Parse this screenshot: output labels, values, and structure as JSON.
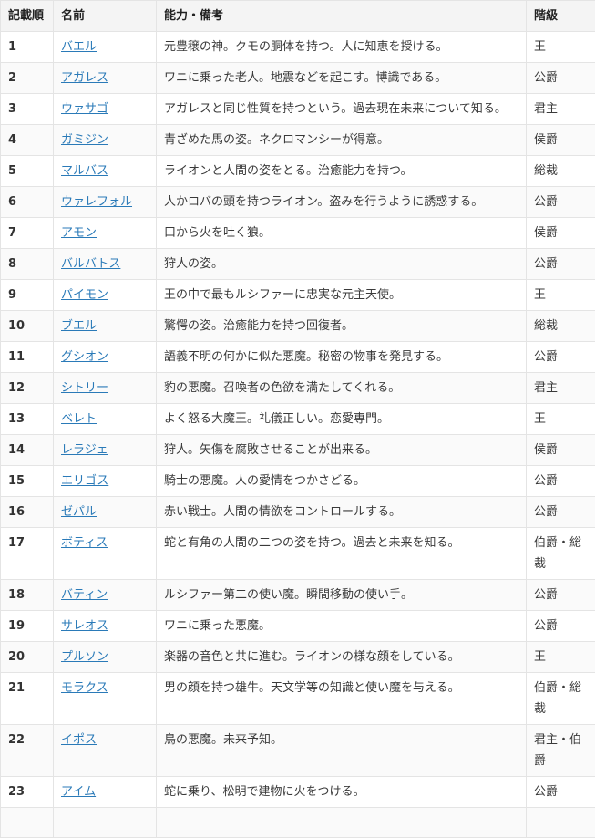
{
  "headers": {
    "no": "記載順",
    "name": "名前",
    "desc": "能力・備考",
    "rank": "階級"
  },
  "rows": [
    {
      "no": "1",
      "name": "バエル",
      "desc": "元豊穣の神。クモの胴体を持つ。人に知恵を授ける。",
      "rank": "王"
    },
    {
      "no": "2",
      "name": "アガレス",
      "desc": "ワニに乗った老人。地震などを起こす。博識である。",
      "rank": "公爵"
    },
    {
      "no": "3",
      "name": "ウァサゴ",
      "desc": "アガレスと同じ性質を持つという。過去現在未来について知る。",
      "rank": "君主"
    },
    {
      "no": "4",
      "name": "ガミジン",
      "desc": "青ざめた馬の姿。ネクロマンシーが得意。",
      "rank": "侯爵"
    },
    {
      "no": "5",
      "name": "マルバス",
      "desc": "ライオンと人間の姿をとる。治癒能力を持つ。",
      "rank": "総裁"
    },
    {
      "no": "6",
      "name": "ウァレフォル",
      "desc": "人かロバの頭を持つライオン。盗みを行うように誘惑する。",
      "rank": "公爵"
    },
    {
      "no": "7",
      "name": "アモン",
      "desc": "口から火を吐く狼。",
      "rank": "侯爵"
    },
    {
      "no": "8",
      "name": "バルバトス",
      "desc": "狩人の姿。",
      "rank": "公爵"
    },
    {
      "no": "9",
      "name": "パイモン",
      "desc": "王の中で最もルシファーに忠実な元主天使。",
      "rank": "王"
    },
    {
      "no": "10",
      "name": "ブエル",
      "desc": "驚愕の姿。治癒能力を持つ回復者。",
      "rank": "総裁"
    },
    {
      "no": "11",
      "name": "グシオン",
      "desc": "語義不明の何かに似た悪魔。秘密の物事を発見する。",
      "rank": "公爵"
    },
    {
      "no": "12",
      "name": "シトリー",
      "desc": "豹の悪魔。召喚者の色欲を満たしてくれる。",
      "rank": "君主"
    },
    {
      "no": "13",
      "name": "ベレト",
      "desc": "よく怒る大魔王。礼儀正しい。恋愛専門。",
      "rank": "王"
    },
    {
      "no": "14",
      "name": "レラジェ",
      "desc": "狩人。矢傷を腐敗させることが出来る。",
      "rank": "侯爵"
    },
    {
      "no": "15",
      "name": "エリゴス",
      "desc": "騎士の悪魔。人の愛情をつかさどる。",
      "rank": "公爵"
    },
    {
      "no": "16",
      "name": "ゼパル",
      "desc": "赤い戦士。人間の情欲をコントロールする。",
      "rank": "公爵"
    },
    {
      "no": "17",
      "name": "ボティス",
      "desc": "蛇と有角の人間の二つの姿を持つ。過去と未来を知る。",
      "rank": "伯爵・総裁"
    },
    {
      "no": "18",
      "name": "バティン",
      "desc": "ルシファー第二の使い魔。瞬間移動の使い手。",
      "rank": "公爵"
    },
    {
      "no": "19",
      "name": "サレオス",
      "desc": "ワニに乗った悪魔。",
      "rank": "公爵"
    },
    {
      "no": "20",
      "name": "プルソン",
      "desc": "楽器の音色と共に進む。ライオンの様な顔をしている。",
      "rank": "王"
    },
    {
      "no": "21",
      "name": "モラクス",
      "desc": "男の顔を持つ雄牛。天文学等の知識と使い魔を与える。",
      "rank": "伯爵・総裁"
    },
    {
      "no": "22",
      "name": "イポス",
      "desc": "鳥の悪魔。未来予知。",
      "rank": "君主・伯爵"
    },
    {
      "no": "23",
      "name": "アイム",
      "desc": "蛇に乗り、松明で建物に火をつける。",
      "rank": "公爵"
    }
  ],
  "colors": {
    "link": "#2a7ab8",
    "header_bg": "#f4f4f4",
    "border": "#e4e4e4"
  }
}
